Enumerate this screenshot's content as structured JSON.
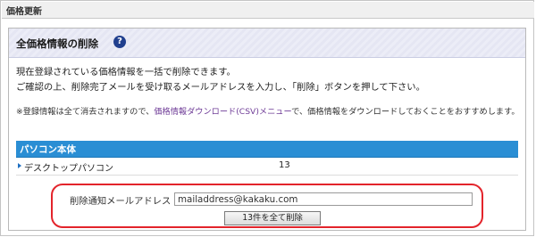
{
  "page": {
    "title": "価格更新"
  },
  "panel": {
    "title": "全価格情報の削除",
    "help_icon": "question-icon",
    "description_line1": "現在登録されている価格情報を一括で削除できます。",
    "description_line2": "ご確認の上、削除完了メールを受け取るメールアドレスを入力し、「削除」ボタンを押して下さい。",
    "note_prefix": "※登録情報は全て消去されますので、",
    "note_link": "価格情報ダウンロード(CSV)メニュー",
    "note_suffix": "で、価格情報をダウンロードしておくことをおすすめします。"
  },
  "section": {
    "title": "パソコン本体",
    "rows": [
      {
        "name": "デスクトップパソコン",
        "count": "13"
      }
    ]
  },
  "form": {
    "email_label": "削除通知メールアドレス",
    "email_value": "mailaddress@kakaku.com",
    "delete_button": "13件を全て削除"
  },
  "colors": {
    "section_header": "#2a8ed4",
    "highlight_border": "#e3242b",
    "link": "#6f3c97"
  }
}
